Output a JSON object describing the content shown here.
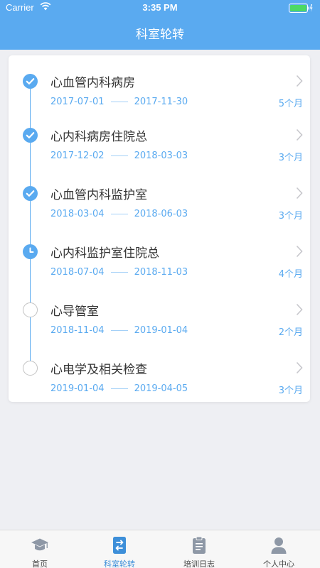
{
  "status_bar": {
    "carrier": "Carrier",
    "time": "3:35 PM"
  },
  "nav": {
    "title": "科室轮转"
  },
  "rotations": [
    {
      "title": "心血管内科病房",
      "start": "2017-07-01",
      "end": "2017-11-30",
      "duration": "5个月",
      "status": "done"
    },
    {
      "title": "心内科病房住院总",
      "start": "2017-12-02",
      "end": "2018-03-03",
      "duration": "3个月",
      "status": "done"
    },
    {
      "title": "心血管内科监护室",
      "start": "2018-03-04",
      "end": "2018-06-03",
      "duration": "3个月",
      "status": "done"
    },
    {
      "title": "心内科监护室住院总",
      "start": "2018-07-04",
      "end": "2018-11-03",
      "duration": "4个月",
      "status": "current"
    },
    {
      "title": "心导管室",
      "start": "2018-11-04",
      "end": "2019-01-04",
      "duration": "2个月",
      "status": "pending"
    },
    {
      "title": "心电学及相关检查",
      "start": "2019-01-04",
      "end": "2019-04-05",
      "duration": "3个月",
      "status": "pending"
    }
  ],
  "tabs": [
    {
      "label": "首页",
      "icon": "graduation-cap-icon"
    },
    {
      "label": "科室轮转",
      "icon": "rotation-icon",
      "active": true
    },
    {
      "label": "培训日志",
      "icon": "clipboard-icon"
    },
    {
      "label": "个人中心",
      "icon": "person-icon"
    }
  ],
  "colors": {
    "accent": "#5aaaf0",
    "active_tab": "#3d8fd9",
    "background": "#eeeff3"
  }
}
